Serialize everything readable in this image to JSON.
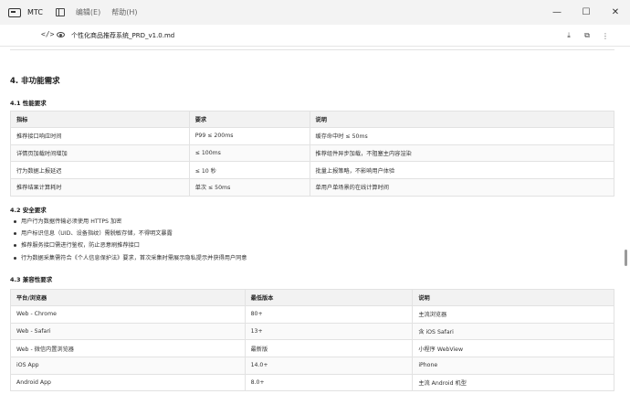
{
  "window": {
    "app_name": "MTC",
    "menu": [
      "编辑(E)",
      "帮助(H)"
    ],
    "controls": [
      "minimize-icon",
      "maximize-icon",
      "close-icon"
    ]
  },
  "file": {
    "name": "个性化商品推荐系统_PRD_v1.0.md",
    "actions": [
      "download-icon",
      "open-external-icon",
      "more-icon"
    ]
  },
  "document": {
    "h2_nonfunctional": "4. 非功能需求",
    "h3_performance": "4.1 性能要求",
    "performance_table": {
      "headers": [
        "指标",
        "要求",
        "说明"
      ],
      "rows": [
        [
          "推荐接口响应时间",
          "P99 ≤ 200ms",
          "缓存命中时 ≤ 50ms"
        ],
        [
          "详情页加载时间增加",
          "≤ 100ms",
          "推荐组件异步加载，不阻塞主内容渲染"
        ],
        [
          "行为数据上报延迟",
          "≤ 10 秒",
          "批量上报策略，不影响用户体验"
        ],
        [
          "推荐结果计算耗时",
          "单次 ≤ 50ms",
          "单用户单场景的在线计算时间"
        ]
      ]
    },
    "h3_security": "4.2 安全要求",
    "security_items": [
      "用户行为数据传输必须使用 HTTPS 加密",
      "用户标识信息（UID、设备指纹）需脱敏存储，不得明文暴露",
      "推荐服务接口需进行鉴权，防止恶意刷推荐接口",
      "行为数据采集需符合《个人信息保护法》要求，首次采集时需展示隐私提示并获得用户同意"
    ],
    "h3_compat": "4.3 兼容性要求",
    "compat_table": {
      "headers": [
        "平台/浏览器",
        "最低版本",
        "说明"
      ],
      "rows": [
        [
          "Web - Chrome",
          "80+",
          "主流浏览器"
        ],
        [
          "Web - Safari",
          "13+",
          "含 iOS Safari"
        ],
        [
          "Web - 微信内置浏览器",
          "最新版",
          "小程序 WebView"
        ],
        [
          "iOS App",
          "14.0+",
          "iPhone"
        ],
        [
          "Android App",
          "8.0+",
          "主流 Android 机型"
        ]
      ]
    }
  }
}
